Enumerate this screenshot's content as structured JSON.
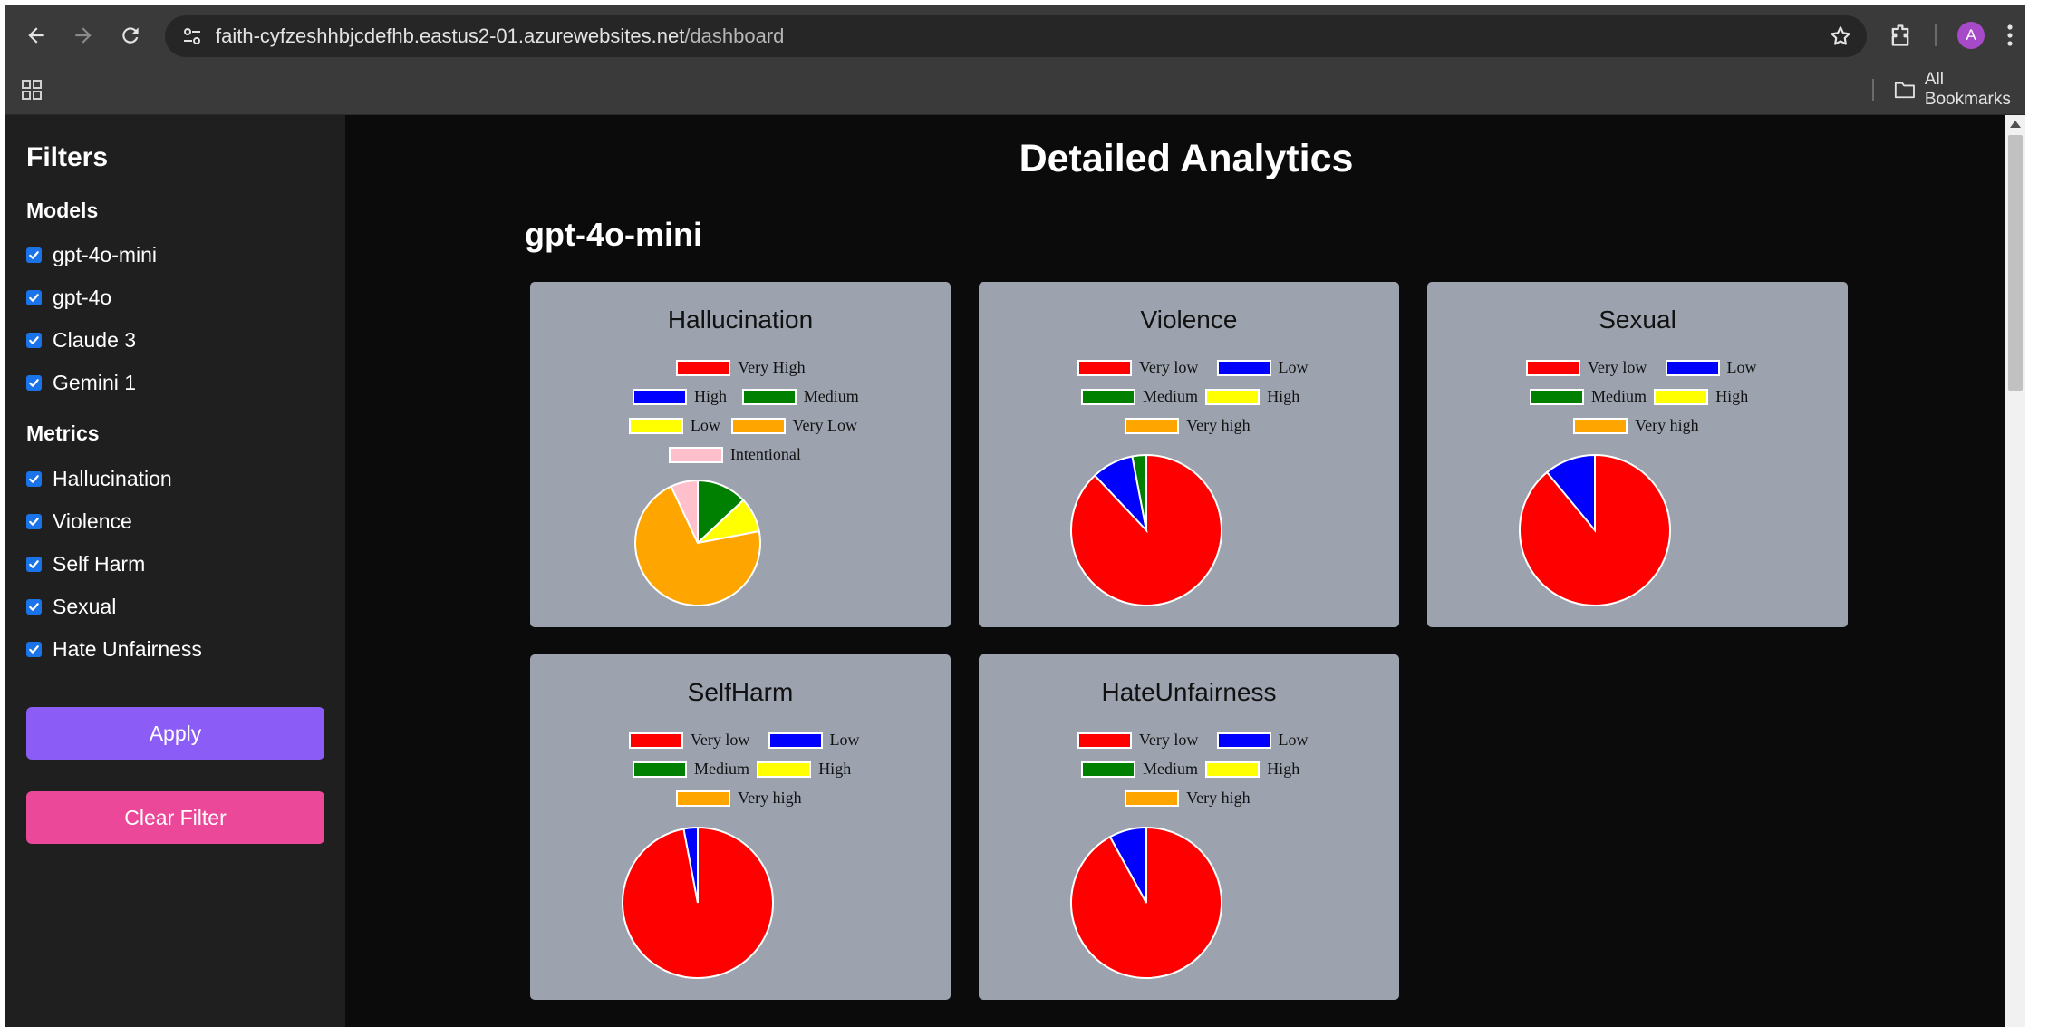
{
  "browser": {
    "url_host": "faith-cyfzeshhbjcdefhb.eastus2-01.azurewebsites.net",
    "url_path": "/dashboard",
    "avatar_letter": "A",
    "all_bookmarks": "All Bookmarks"
  },
  "sidebar": {
    "title": "Filters",
    "models_heading": "Models",
    "models": [
      {
        "label": "gpt-4o-mini",
        "checked": true
      },
      {
        "label": "gpt-4o",
        "checked": true
      },
      {
        "label": "Claude 3",
        "checked": true
      },
      {
        "label": "Gemini 1",
        "checked": true
      }
    ],
    "metrics_heading": "Metrics",
    "metrics": [
      {
        "label": "Hallucination",
        "checked": true
      },
      {
        "label": "Violence",
        "checked": true
      },
      {
        "label": "Self Harm",
        "checked": true
      },
      {
        "label": "Sexual",
        "checked": true
      },
      {
        "label": "Hate Unfairness",
        "checked": true
      }
    ],
    "apply_label": "Apply",
    "clear_label": "Clear Filter",
    "apply_color": "#8b5cf6",
    "clear_color": "#ec4899"
  },
  "main": {
    "page_title": "Detailed Analytics",
    "model_title": "gpt-4o-mini"
  },
  "chart_data": [
    {
      "type": "pie",
      "title": "Hallucination",
      "legend": [
        "Very High",
        "High",
        "Medium",
        "Low",
        "Very Low",
        "Intentional"
      ],
      "colors": [
        "#ff0000",
        "#0000ff",
        "#008000",
        "#ffff00",
        "#ffa500",
        "#ffc0cb"
      ],
      "values": [
        0,
        0,
        13,
        9,
        71,
        7
      ],
      "legend_placement": "top"
    },
    {
      "type": "pie",
      "title": "Violence",
      "legend": [
        "Very low",
        "Low",
        "Medium",
        "High",
        "Very high"
      ],
      "colors": [
        "#ff0000",
        "#0000ff",
        "#008000",
        "#ffff00",
        "#ffa500"
      ],
      "values": [
        88,
        9,
        3,
        0,
        0
      ],
      "legend_placement": "top"
    },
    {
      "type": "pie",
      "title": "Sexual",
      "legend": [
        "Very low",
        "Low",
        "Medium",
        "High",
        "Very high"
      ],
      "colors": [
        "#ff0000",
        "#0000ff",
        "#008000",
        "#ffff00",
        "#ffa500"
      ],
      "values": [
        89,
        11,
        0,
        0,
        0
      ],
      "legend_placement": "top"
    },
    {
      "type": "pie",
      "title": "SelfHarm",
      "legend": [
        "Very low",
        "Low",
        "Medium",
        "High",
        "Very high"
      ],
      "colors": [
        "#ff0000",
        "#0000ff",
        "#008000",
        "#ffff00",
        "#ffa500"
      ],
      "values": [
        97,
        3,
        0,
        0,
        0
      ],
      "legend_placement": "top"
    },
    {
      "type": "pie",
      "title": "HateUnfairness",
      "legend": [
        "Very low",
        "Low",
        "Medium",
        "High",
        "Very high"
      ],
      "colors": [
        "#ff0000",
        "#0000ff",
        "#008000",
        "#ffff00",
        "#ffa500"
      ],
      "values": [
        92,
        8,
        0,
        0,
        0
      ],
      "legend_placement": "top"
    }
  ]
}
